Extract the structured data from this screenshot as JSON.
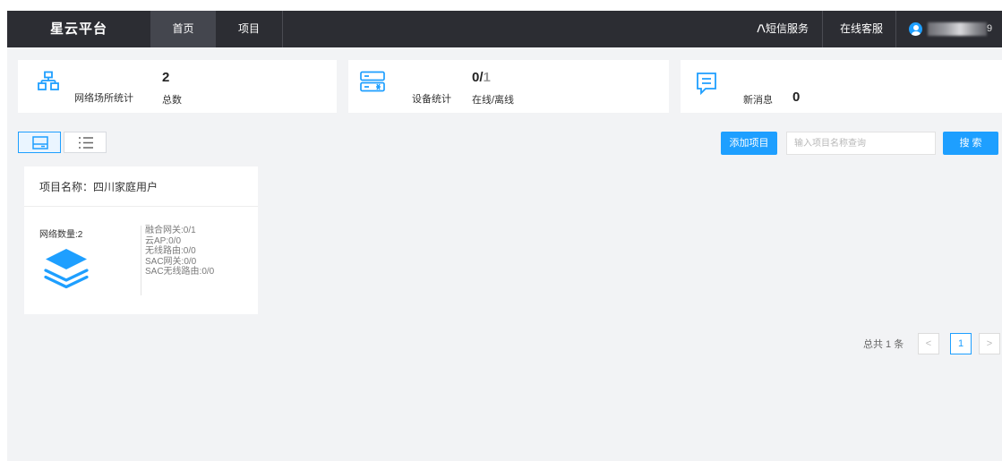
{
  "topbar": {
    "brand": "星云平台",
    "nav": [
      "首页",
      "项目"
    ],
    "sms_service": "短信服务",
    "online_support": "在线客服",
    "username_suffix": "9"
  },
  "stats": {
    "network_sites": {
      "label": "网络场所统计",
      "value": "2",
      "sub": "总数"
    },
    "devices": {
      "label": "设备统计",
      "online": "0",
      "separator": "/",
      "total": "1",
      "sub": "在线/离线"
    },
    "messages": {
      "label": "新消息",
      "value": "0"
    }
  },
  "toolbar": {
    "add_project": "添加项目",
    "search_placeholder": "输入项目名称查询",
    "search_button": "搜 索"
  },
  "project_card": {
    "title": "项目名称：四川家庭用户",
    "network_count": "网络数量:2",
    "details": [
      "融合网关:0/1",
      "云AP:0/0",
      "无线路由:0/0",
      "SAC网关:0/0",
      "SAC无线路由:0/0"
    ]
  },
  "pagination": {
    "total_text": "总共 1 条",
    "prev": "<",
    "current_page": "1",
    "next": ">"
  },
  "colors": {
    "accent": "#1e9fff",
    "topbar": "#2c2d33",
    "background": "#f2f3f5"
  }
}
